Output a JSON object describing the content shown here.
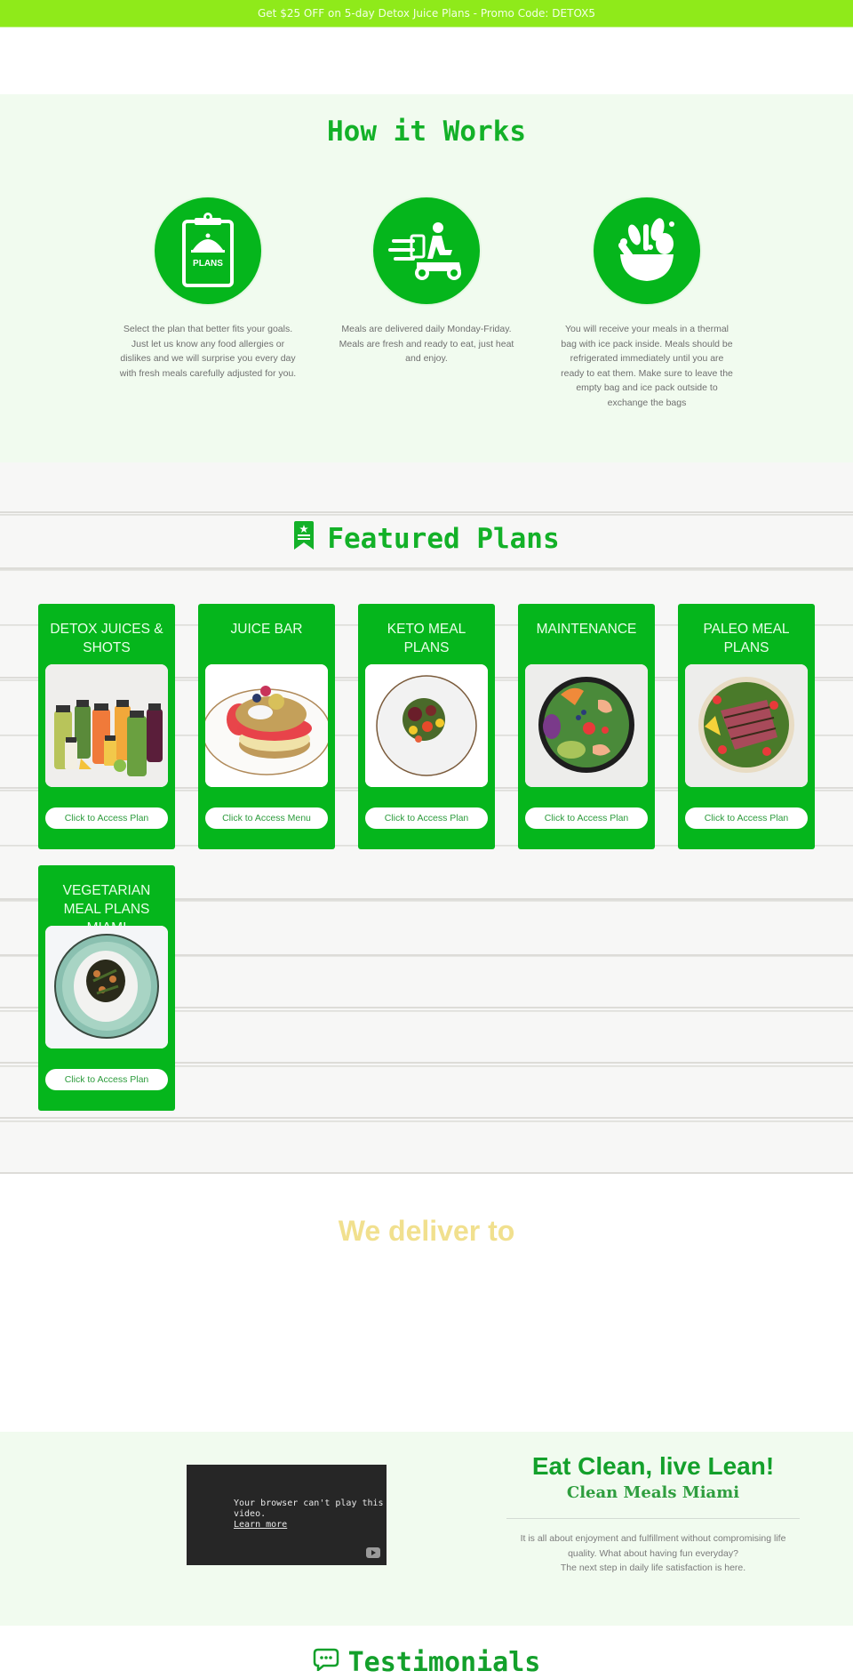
{
  "promo": {
    "text": "Get $25 OFF on 5-day Detox Juice Plans - Promo Code: DETOX5"
  },
  "how_it_works": {
    "title": "How it Works",
    "steps": [
      {
        "icon": "clipboard-plans-icon",
        "icon_label": "PLANS",
        "text": "Select the plan that better fits your goals. Just let us know any food allergies or dislikes and we will surprise you every day with fresh meals carefully adjusted for you."
      },
      {
        "icon": "delivery-scooter-icon",
        "text": "Meals are delivered daily Monday-Friday. Meals are fresh and ready to eat, just heat and enjoy."
      },
      {
        "icon": "salad-bowl-icon",
        "text": "You will receive your meals in a thermal bag with ice pack inside. Meals should be refrigerated immediately until you are ready to eat them. Make sure to leave the empty bag and ice pack outside to exchange the bags"
      }
    ]
  },
  "featured": {
    "title": "Featured Plans",
    "icon": "bookmark-star-icon",
    "plans": [
      {
        "title": "Detox Juices & Shots",
        "image": "juice-bottles",
        "button": "Click to Access Plan"
      },
      {
        "title": "Juice Bar",
        "image": "pancake-stack",
        "button": "Click to Access Menu"
      },
      {
        "title": "Keto Meal Plans",
        "image": "keto-plate",
        "button": "Click to Access Plan"
      },
      {
        "title": "Maintenance",
        "image": "shrimp-salad-bowl",
        "button": "Click to Access Plan"
      },
      {
        "title": "Paleo Meal Plans",
        "image": "tuna-salad-bowl",
        "button": "Click to Access Plan"
      },
      {
        "title": "Vegetarian Meal Plans Miami",
        "image": "rice-veggie-plate",
        "button": "Click to Access Plan"
      }
    ]
  },
  "deliver": {
    "title": "We deliver to"
  },
  "about": {
    "video_message": "Your browser can't play this video.",
    "video_link": "Learn more",
    "title": "Eat Clean, live Lean!",
    "subtitle": "Clean Meals Miami",
    "text_line1": "It is all about enjoyment and fulfillment without compromising life quality. What about having fun everyday?",
    "text_line2": "The next step in daily life satisfaction is here."
  },
  "testimonials": {
    "title": "Testimonials",
    "icon": "chat-bubble-icon"
  },
  "colors": {
    "promo_bg": "#8fea1a",
    "brand_green": "#05b61c",
    "heading_green": "#13b128",
    "deliver_yellow": "#f1e08e",
    "section_bg": "#f1fbef"
  }
}
